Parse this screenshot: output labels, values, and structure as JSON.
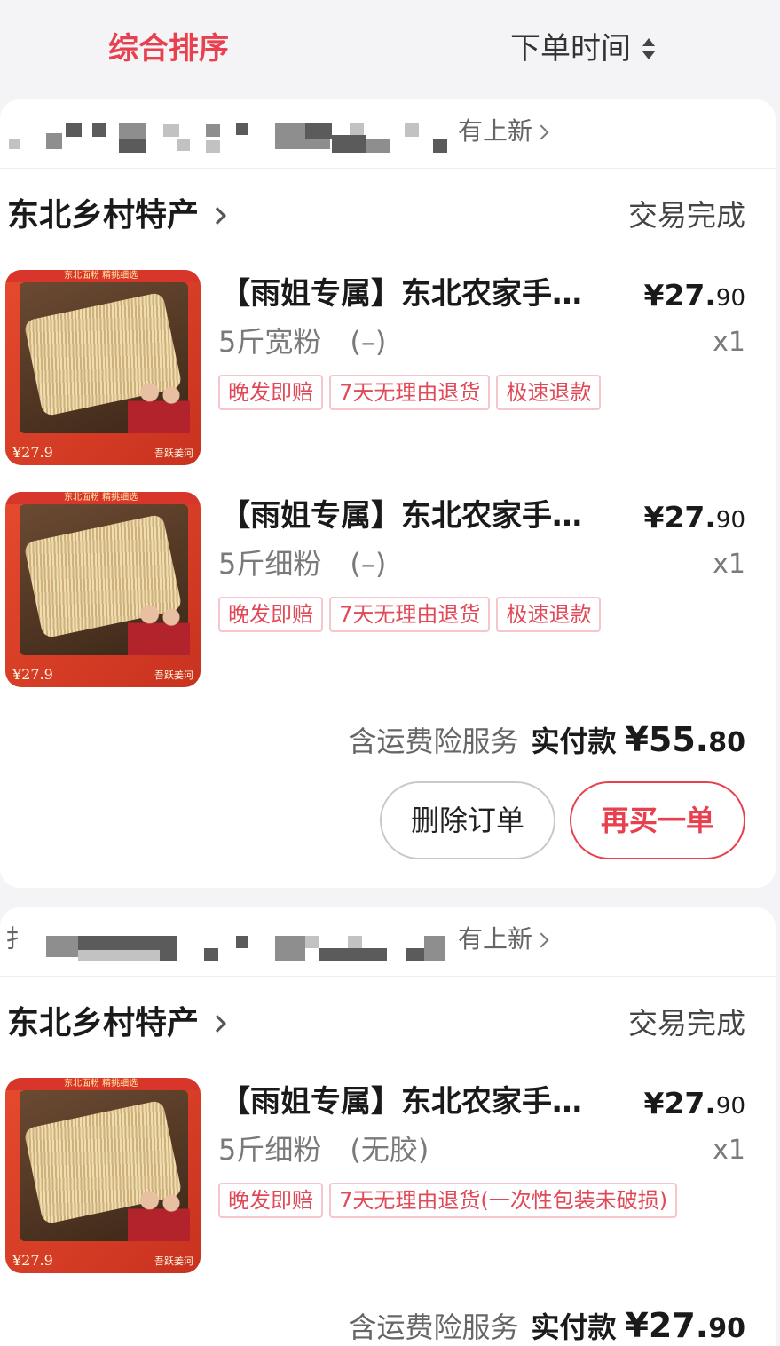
{
  "sort": {
    "active_label": "综合排序",
    "time_label": "下单时间"
  },
  "orders": [
    {
      "store_new_label": "有上新",
      "shop_name": "东北乡村特产",
      "status": "交易完成",
      "items": [
        {
          "title": "【雨姐专属】东北农家手…",
          "price_main": "¥27.",
          "price_dec": "90",
          "spec": "5斤宽粉　(–)",
          "qty": "x1",
          "tags": [
            "晚发即赔",
            "7天无理由退货",
            "极速退款"
          ],
          "thumb_price": "¥27.9",
          "thumb_brand": "吾跃姜河",
          "thumb_banner": "东北面粉 精挑细选"
        },
        {
          "title": "【雨姐专属】东北农家手…",
          "price_main": "¥27.",
          "price_dec": "90",
          "spec": "5斤细粉　(–)",
          "qty": "x1",
          "tags": [
            "晚发即赔",
            "7天无理由退货",
            "极速退款"
          ],
          "thumb_price": "¥27.9",
          "thumb_brand": "吾跃姜河",
          "thumb_banner": "东北面粉 精挑细选"
        }
      ],
      "total": {
        "service": "含运费险服务",
        "label": "实付款",
        "amount_main": "¥55.",
        "amount_dec": "80"
      },
      "buttons": {
        "delete": "删除订单",
        "rebuy": "再买一单"
      }
    },
    {
      "store_new_label": "有上新",
      "store_prefix": "扌",
      "shop_name": "东北乡村特产",
      "status": "交易完成",
      "items": [
        {
          "title": "【雨姐专属】东北农家手…",
          "price_main": "¥27.",
          "price_dec": "90",
          "spec": "5斤细粉　(无胶)",
          "qty": "x1",
          "tags": [
            "晚发即赔",
            "7天无理由退货(一次性包装未破损)"
          ],
          "thumb_price": "¥27.9",
          "thumb_brand": "吾跃姜河",
          "thumb_banner": "东北面粉 精挑细选"
        }
      ],
      "total": {
        "service": "含运费险服务",
        "label": "实付款",
        "amount_main": "¥27.",
        "amount_dec": "90"
      }
    }
  ],
  "colors": {
    "accent": "#e8404f",
    "tag_border": "#f5c6cc",
    "background": "#f4f4f6"
  }
}
